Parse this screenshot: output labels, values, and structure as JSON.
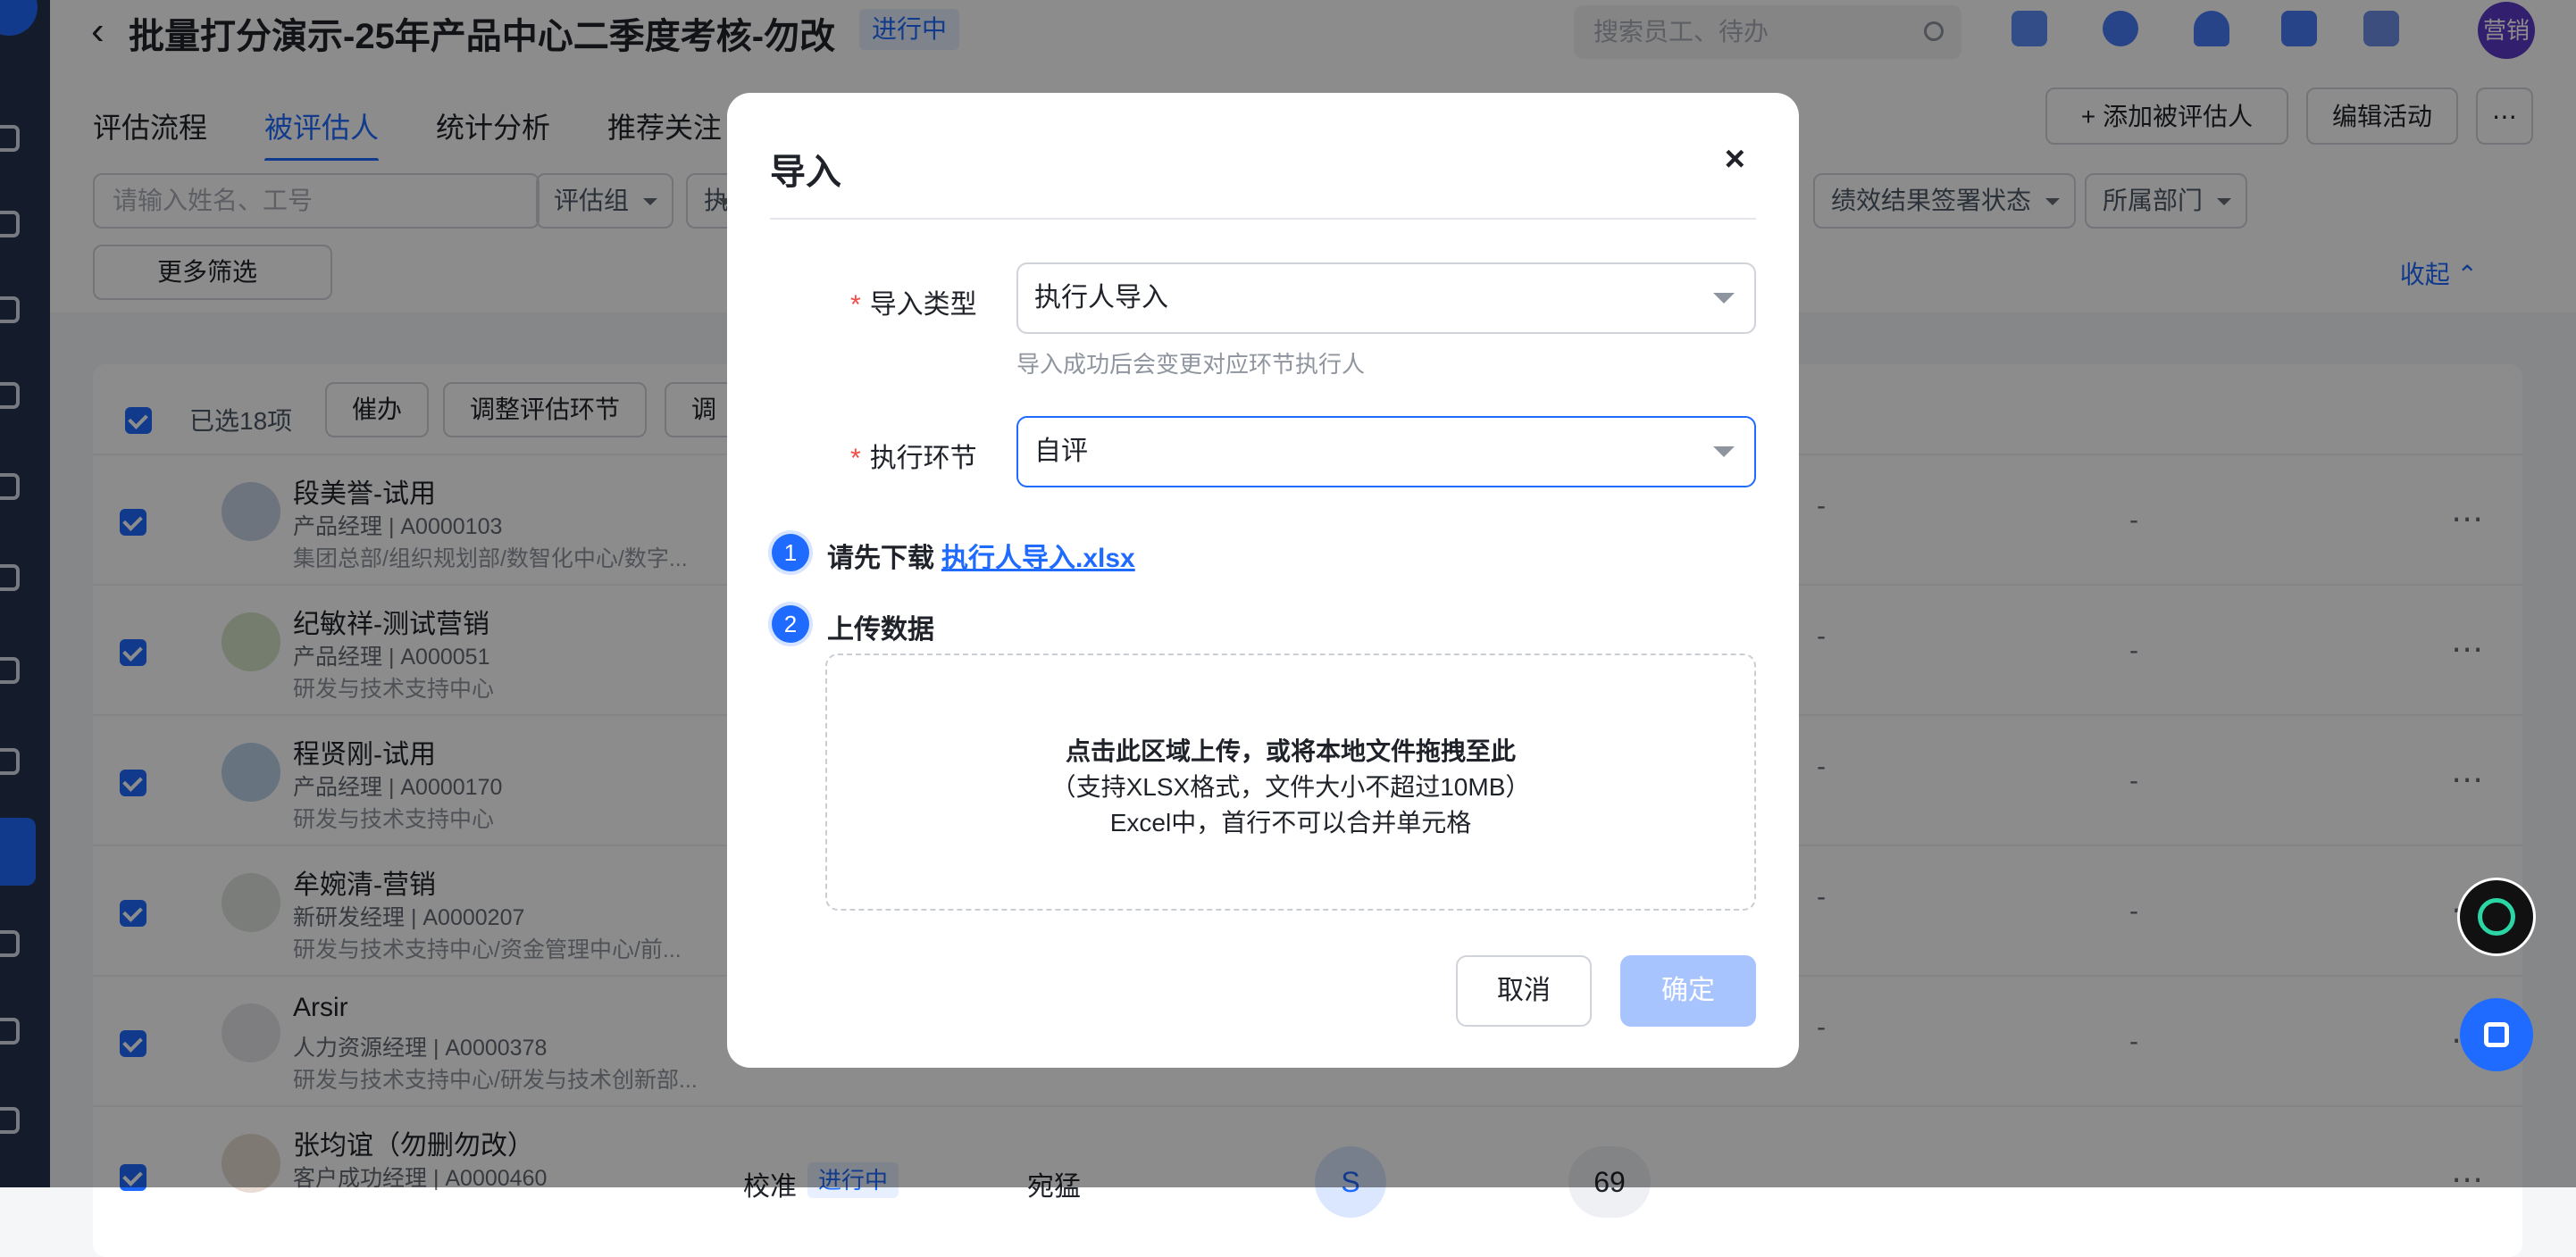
{
  "header": {
    "title": "批量打分演示-25年产品中心二季度考核-勿改",
    "status": "进行中",
    "search_placeholder": "搜索员工、待办",
    "user_avatar": "营销"
  },
  "tabs": [
    "评估流程",
    "被评估人",
    "统计分析",
    "推荐关注"
  ],
  "header_buttons": {
    "add": "添加被评估人",
    "edit": "编辑活动",
    "more": "⋯"
  },
  "filters": {
    "name_placeholder": "请输入姓名、工号",
    "group": "评估组",
    "executor": "执",
    "sign_status": "绩效结果签署状态",
    "department": "所属部门",
    "more_filters": "更多筛选",
    "collapse": "收起"
  },
  "toolbar": {
    "selected": "已选18项",
    "remind": "催办",
    "adjust": "调整评估环节",
    "adjust2": "调"
  },
  "rows": [
    {
      "name": "段美誉-试用",
      "sub": "产品经理 | A0000103",
      "dept": "集团总部/组织规划部/数智化中心/数字...",
      "c1": "-",
      "c2": "-"
    },
    {
      "name": "纪敏祥-测试营销",
      "sub": "产品经理 | A000051",
      "dept": "研发与技术支持中心",
      "c1": "-",
      "c2": "-"
    },
    {
      "name": "程贤刚-试用",
      "sub": "产品经理 | A0000170",
      "dept": "研发与技术支持中心",
      "c1": "-",
      "c2": "-"
    },
    {
      "name": "牟婉清-营销",
      "sub": "新研发经理 | A0000207",
      "dept": "研发与技术支持中心/资金管理中心/前...",
      "c1": "-",
      "c2": "-"
    },
    {
      "name": "Arsir",
      "sub": "人力资源经理 | A0000378",
      "dept": "研发与技术支持中心/研发与技术创新部...",
      "c1": "-",
      "c2": "-"
    },
    {
      "name": "张均谊（勿删勿改）",
      "sub": "客户成功经理 | A0000460",
      "dept": "",
      "c1": "",
      "c2": ""
    }
  ],
  "last_row": {
    "step": "校准",
    "status": "进行中",
    "executor": "宛猛",
    "grade": "S",
    "score": "69"
  },
  "modal": {
    "title": "导入",
    "close": "×",
    "type_label": "导入类型",
    "type_value": "执行人导入",
    "type_hint": "导入成功后会变更对应环节执行人",
    "stage_label": "执行环节",
    "stage_value": "自评",
    "step1_num": "1",
    "step1_text": "请先下载",
    "step1_link": "执行人导入.xlsx",
    "step2_num": "2",
    "step2_text": "上传数据",
    "drop_line1": "点击此区域上传，或将本地文件拖拽至此",
    "drop_line2": "（支持XLSX格式，文件大小不超过10MB）",
    "drop_line3": "Excel中，首行不可以合并单元格",
    "cancel": "取消",
    "confirm": "确定"
  },
  "colors": {
    "accent": "#1f6bff",
    "confirm_disabled": "#a8c4ff",
    "required": "#f54a45"
  }
}
